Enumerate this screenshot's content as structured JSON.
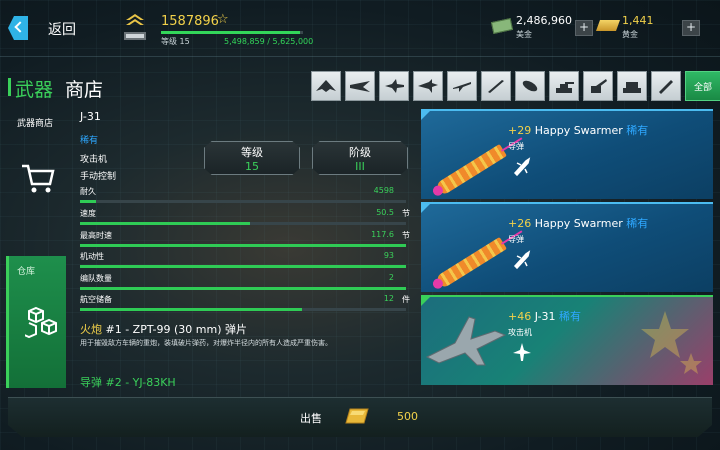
{
  "topbar": {
    "back_label": "返回",
    "xp_value": "1587896",
    "xp_star": "☆",
    "level_label": "等级 15",
    "xp_progress": "5,498,859 / 5,625,000",
    "xp_fraction": 0.978,
    "cash_value": "2,486,960",
    "cash_label": "美金",
    "gold_value": "1,441",
    "gold_label": "黄金",
    "plus": "+"
  },
  "header": {
    "title_main": "武器",
    "title_sub": "商店",
    "filter_all_label": "全部",
    "filter_icons": [
      "flying-wing-icon",
      "stealth-bomber-icon",
      "fighter-jet-icon",
      "delta-jet-icon",
      "attack-jet-icon",
      "missile-icon",
      "bomb-icon",
      "turret-icon",
      "cannon-icon",
      "launcher-icon",
      "rocket-icon"
    ]
  },
  "leftnav": {
    "shop_label": "武器商店",
    "warehouse_label": "仓库"
  },
  "details": {
    "name": "J-31",
    "rarity": "稀有",
    "type": "攻击机",
    "control": "手动控制",
    "level_box": {
      "label": "等级",
      "value": "15"
    },
    "tier_box": {
      "label": "阶级",
      "value": "III"
    },
    "stats": [
      {
        "name": "耐久",
        "value": "4598",
        "unit": "",
        "fill": 0.05
      },
      {
        "name": "速度",
        "value": "50.5",
        "unit": "节",
        "fill": 0.52
      },
      {
        "name": "最高时速",
        "value": "117.6",
        "unit": "节",
        "fill": 1.0
      },
      {
        "name": "机动性",
        "value": "93",
        "unit": "",
        "fill": 1.0
      },
      {
        "name": "编队数量",
        "value": "2",
        "unit": "",
        "fill": 1.0
      },
      {
        "name": "航空储备",
        "value": "12",
        "unit": "件",
        "fill": 0.68
      }
    ],
    "weapon1_type": "火炮",
    "weapon1_rest": " #1 - ZPT-99 (30 mm) 弹片",
    "weapon1_desc": "用于摧毁敌方车辆的重炮，装填破片弹药，对爆炸半径内的所有人造成严重伤害。",
    "weapon2": "导弹 #2 - YJ-83KH"
  },
  "cards": [
    {
      "plus": "+29",
      "name": " Happy Swarmer ",
      "rarity": "稀有",
      "sub": "导弹"
    },
    {
      "plus": "+26",
      "name": " Happy Swarmer ",
      "rarity": "稀有",
      "sub": "导弹"
    },
    {
      "plus": "+46",
      "name": " J-31 ",
      "rarity": "稀有",
      "sub": "攻击机"
    }
  ],
  "bottom": {
    "sell_label": "出售",
    "sell_price": "500"
  },
  "colors": {
    "accent_green": "#3ad05a",
    "gold": "#f2d14a",
    "rare_blue": "#2ea8ff"
  }
}
